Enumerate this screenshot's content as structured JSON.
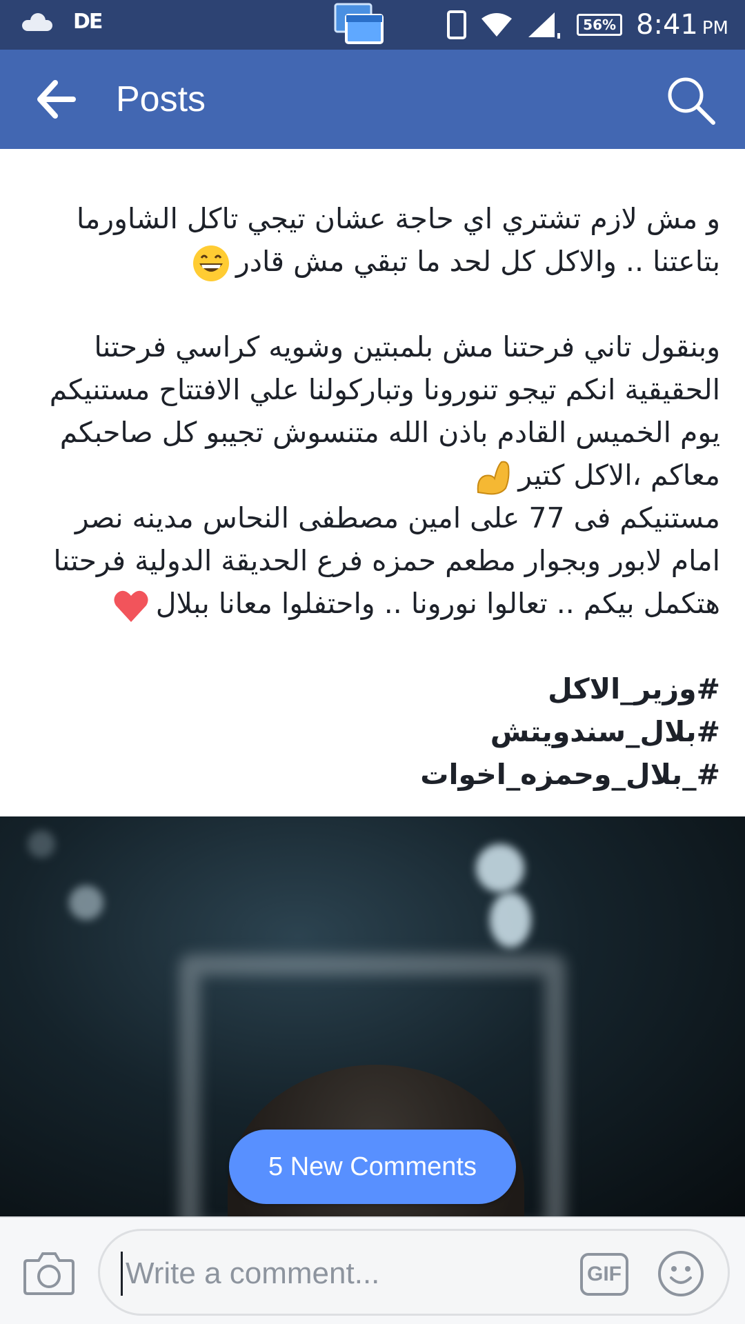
{
  "status_bar": {
    "battery": "56%",
    "time": "8:41",
    "ampm": "PM",
    "icons": [
      "cloud-icon",
      "de-app-icon",
      "screencast-icon",
      "phone-icon",
      "wifi-icon",
      "signal-icon",
      "battery-icon"
    ]
  },
  "app_bar": {
    "title": "Posts",
    "back_icon": "arrow-left-icon",
    "search_icon": "search-icon",
    "color": "#4267b2"
  },
  "post": {
    "lines": [
      "و مش لازم تشتري اي حاجة عشان تيجي تاكل الشاورما",
      "بتاعتنا  .. والاكل كل لحد ما تبقي مش قادر",
      "وبنقول تاني فرحتنا مش بلمبتين وشويه كراسي فرحتنا",
      "الحقيقية انكم تيجو تنورونا وتباركولنا علي الافتتاح مستنيكم",
      "يوم الخميس القادم باذن الله متنسوش تجيبو كل صاحبكم",
      "معاكم  ،الاكل كتير",
      "مستنيكم فى 77 على امين مصطفى النحاس مدينه نصر",
      "امام لابور وبجوار مطعم حمزه فرع الحديقة الدولية فرحتنا",
      "هتكمل بيكم .. تعالوا نورونا .. واحتفلوا معانا ببلال"
    ],
    "hashtags": [
      "#وزير_الاكل",
      "#بلال_سندويتش",
      "#_بلال_وحمزه_اخوات"
    ],
    "emojis": [
      "grinning-face-emoji",
      "flexed-biceps-emoji",
      "red-heart-emoji"
    ]
  },
  "new_comments_label": "5 New Comments",
  "composer": {
    "placeholder": "Write a comment...",
    "gif_label": "GIF",
    "camera_icon": "camera-icon",
    "emoji_icon": "smiley-icon",
    "accent": "#5890ff"
  }
}
